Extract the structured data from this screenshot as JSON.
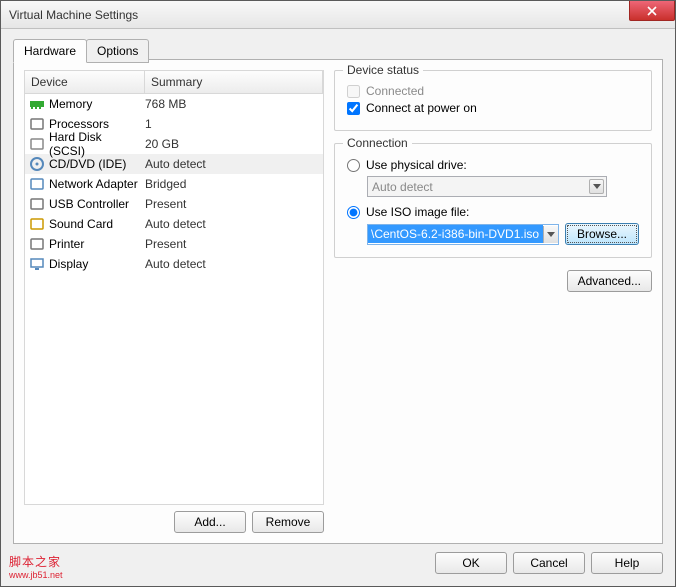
{
  "window": {
    "title": "Virtual Machine Settings"
  },
  "tabs": {
    "hardware": "Hardware",
    "options": "Options"
  },
  "headers": {
    "device": "Device",
    "summary": "Summary"
  },
  "devices": [
    {
      "icon": "memory-icon",
      "name": "Memory",
      "summary": "768 MB",
      "selected": false
    },
    {
      "icon": "cpu-icon",
      "name": "Processors",
      "summary": "1",
      "selected": false
    },
    {
      "icon": "disk-icon",
      "name": "Hard Disk (SCSI)",
      "summary": "20 GB",
      "selected": false
    },
    {
      "icon": "cd-icon",
      "name": "CD/DVD (IDE)",
      "summary": "Auto detect",
      "selected": true
    },
    {
      "icon": "net-icon",
      "name": "Network Adapter",
      "summary": "Bridged",
      "selected": false
    },
    {
      "icon": "usb-icon",
      "name": "USB Controller",
      "summary": "Present",
      "selected": false
    },
    {
      "icon": "sound-icon",
      "name": "Sound Card",
      "summary": "Auto detect",
      "selected": false
    },
    {
      "icon": "printer-icon",
      "name": "Printer",
      "summary": "Present",
      "selected": false
    },
    {
      "icon": "display-icon",
      "name": "Display",
      "summary": "Auto detect",
      "selected": false
    }
  ],
  "buttons": {
    "add": "Add...",
    "remove": "Remove",
    "browse": "Browse...",
    "advanced": "Advanced...",
    "ok": "OK",
    "cancel": "Cancel",
    "help": "Help"
  },
  "status": {
    "legend": "Device status",
    "connected": "Connected",
    "poweron": "Connect at power on"
  },
  "connection": {
    "legend": "Connection",
    "physical": "Use physical drive:",
    "physical_value": "Auto detect",
    "iso": "Use ISO image file:",
    "iso_value": "\\CentOS-6.2-i386-bin-DVD1.iso"
  },
  "watermark": {
    "main": "脚本之家",
    "sub": "www.jb51.net"
  }
}
